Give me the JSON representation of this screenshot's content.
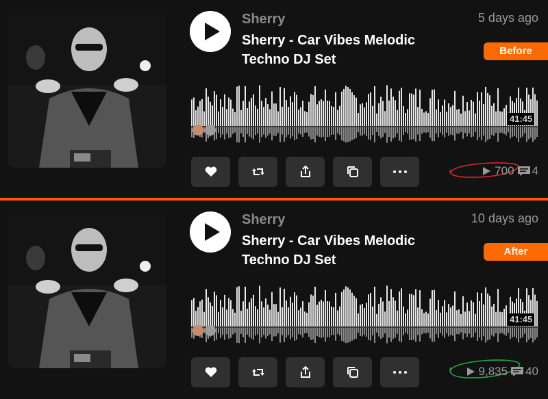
{
  "posts": [
    {
      "artist": "Sherry",
      "title": "Sherry - Car Vibes Melodic Techno DJ Set",
      "date": "5 days ago",
      "badge": "Before",
      "duration": "41:45",
      "plays": "700",
      "comments": "4",
      "annotation_color": "#d62a2a",
      "actions": [
        "like",
        "repost",
        "share",
        "copy-link",
        "more"
      ],
      "icons": [
        "heart-icon",
        "repost-icon",
        "share-icon",
        "copy-icon",
        "more-icon"
      ]
    },
    {
      "artist": "Sherry",
      "title": "Sherry - Car Vibes Melodic Techno DJ Set",
      "date": "10 days ago",
      "badge": "After",
      "duration": "41:45",
      "plays": "9,835",
      "comments": "40",
      "annotation_color": "#27a845",
      "actions": [
        "like",
        "repost",
        "share",
        "copy-link",
        "more"
      ],
      "icons": [
        "heart-icon",
        "repost-icon",
        "share-icon",
        "copy-icon",
        "more-icon"
      ]
    }
  ],
  "colors": {
    "accent": "#ff5500",
    "badge": "#ff6a00",
    "background": "#121212",
    "button": "#303030"
  }
}
